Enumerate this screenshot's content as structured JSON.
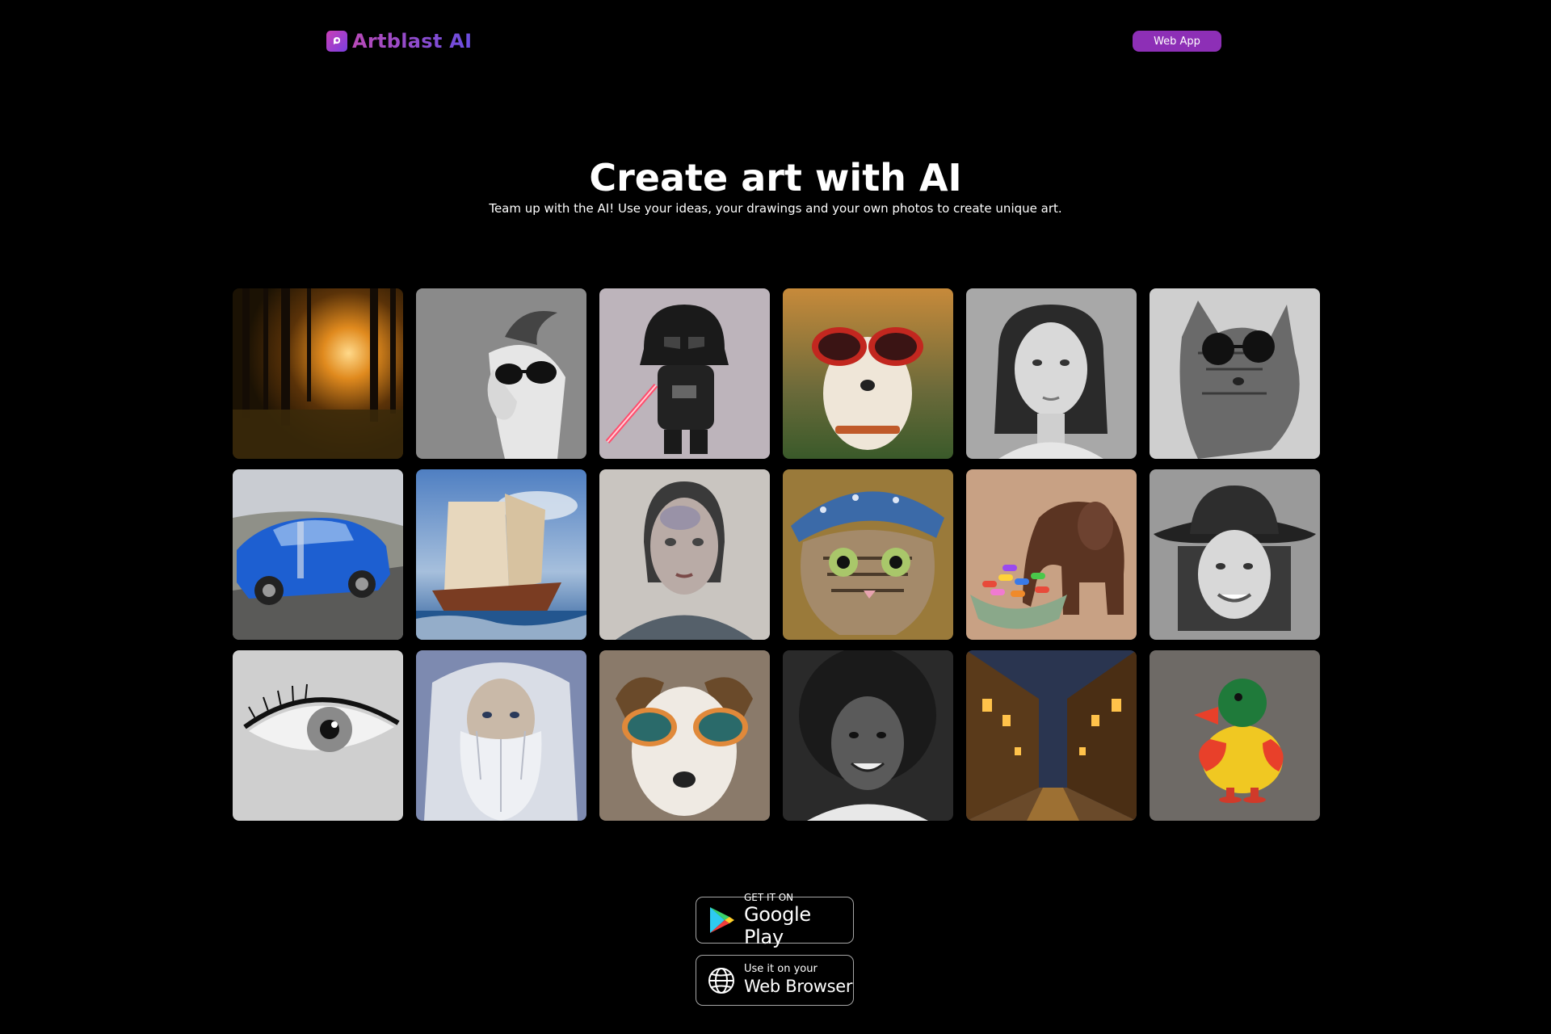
{
  "header": {
    "logo_text": "Artblast AI",
    "web_app_label": "Web App"
  },
  "hero": {
    "title": "Create art with AI",
    "subtitle": "Team up with the AI! Use your ideas, your drawings and your own photos to create unique art."
  },
  "gallery": {
    "tiles": [
      {
        "subject": "sunset forest"
      },
      {
        "subject": "goat with sunglasses"
      },
      {
        "subject": "darth vader figurine"
      },
      {
        "subject": "dog with red sunglasses"
      },
      {
        "subject": "woman portrait"
      },
      {
        "subject": "cat with sunglasses"
      },
      {
        "subject": "blue mustang car"
      },
      {
        "subject": "sailing ship painting"
      },
      {
        "subject": "painted girl portrait"
      },
      {
        "subject": "cat with blue hat"
      },
      {
        "subject": "wooden elephant with candy"
      },
      {
        "subject": "smiling woman with hat"
      },
      {
        "subject": "eye closeup"
      },
      {
        "subject": "old wizard portrait"
      },
      {
        "subject": "dog with goggles"
      },
      {
        "subject": "smiling woman with afro"
      },
      {
        "subject": "old town street at night"
      },
      {
        "subject": "toy duck"
      }
    ]
  },
  "badges": {
    "google_play": {
      "small": "GET IT ON",
      "big": "Google Play"
    },
    "web_browser": {
      "small": "Use it on your",
      "big": "Web Browser"
    }
  },
  "colors": {
    "background": "#000000",
    "accent": "#8d2fb6"
  }
}
